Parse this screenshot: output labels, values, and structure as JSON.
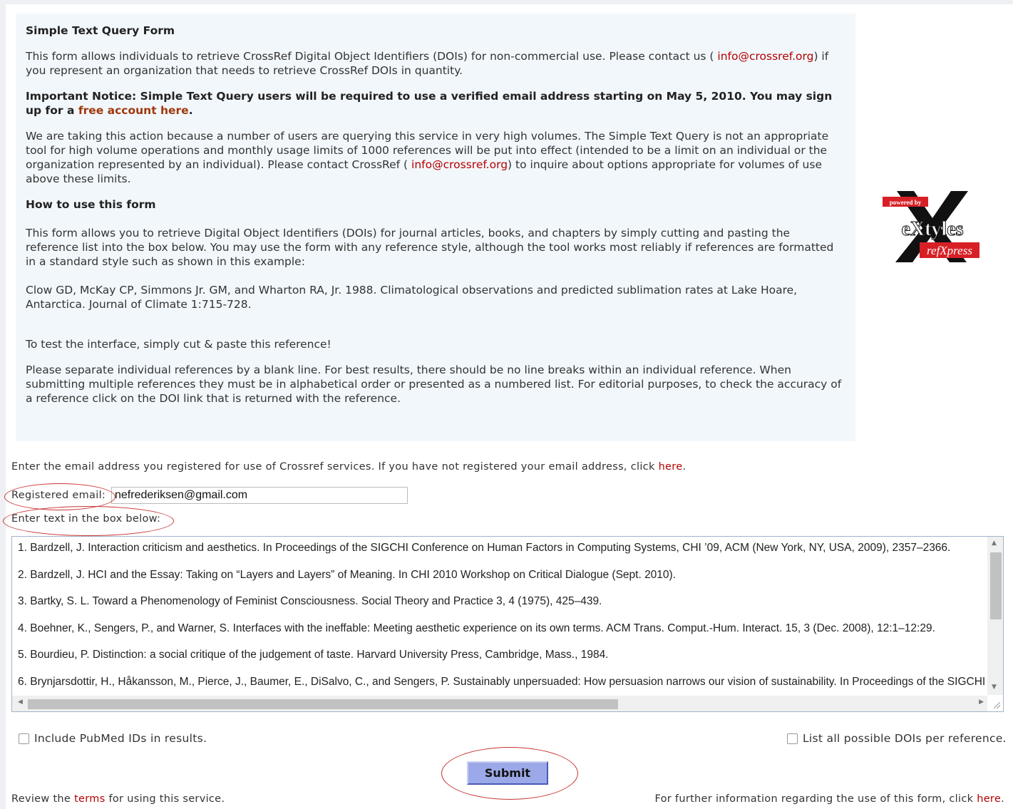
{
  "info": {
    "title": "Simple Text Query Form",
    "intro_before": "This form allows individuals to retrieve CrossRef Digital Object Identifiers (DOIs) for non-commercial use. Please contact us ( ",
    "intro_email": "info@crossref.org",
    "intro_after": ") if you represent an organization that needs to retrieve CrossRef DOIs in quantity.",
    "notice_before": "Important Notice: Simple Text Query users will be required to use a verified email address starting on May 5, 2010. You may sign up for a ",
    "notice_link": "free account here",
    "notice_after": ".",
    "action_before": "We are taking this action because a number of users are querying this service in very high volumes. The Simple Text Query is not an appropriate tool for high volume operations and monthly usage limits of 1000 references will be put into effect (intended to be a limit on an individual or the organization represented by an individual). Please contact CrossRef ( ",
    "action_email": "info@crossref.org",
    "action_after": ") to inquire about options appropriate for volumes of use above these limits.",
    "howto_title": "How to use this form",
    "howto_text": "This form allows you to retrieve Digital Object Identifiers (DOIs) for journal articles, books, and chapters by simply cutting and pasting the reference list into the box below. You may use the form with any reference style, although the tool works most reliably if references are formatted in a standard style such as shown in this example:",
    "example_ref": "Clow GD, McKay CP, Simmons Jr. GM, and Wharton RA, Jr. 1988. Climatological observations and predicted sublimation rates at Lake Hoare, Antarctica. Journal of Climate 1:715-728.",
    "test_text": "To test the interface, simply cut & paste this reference!",
    "separate_text": "Please separate individual references by a blank line. For best results, there should be no line breaks within an individual reference. When submitting multiple references they must be in alphabetical order or presented as a numbered list. For editorial purposes, to check the accuracy of a reference click on the DOI link that is returned with the reference."
  },
  "logo": {
    "tag": "powered by",
    "brand": "eXtyles",
    "product": "refXpress",
    "colors": {
      "red": "#d81f26",
      "black": "#111111"
    }
  },
  "form": {
    "register_text": "Enter the email address you registered for use of Crossref services. If you have not registered your email address, click ",
    "register_link": "here",
    "register_end": ".",
    "email_label": "Registered email:",
    "email_value": "nefrederiksen@gmail.com",
    "textbox_label": "Enter text in the box below:",
    "references": [
      "1. Bardzell, J. Interaction criticism and aesthetics. In Proceedings of the SIGCHI Conference on Human Factors in Computing Systems, CHI ’09, ACM (New York, NY, USA, 2009), 2357–2366.",
      "2. Bardzell, J. HCI and the Essay: Taking on “Layers and Layers” of Meaning. In CHI 2010 Workshop on Critical Dialogue (Sept. 2010).",
      "3. Bartky, S. L. Toward a Phenomenology of Feminist Consciousness. Social Theory and Practice 3, 4 (1975), 425–439.",
      "4. Boehner, K., Sengers, P., and Warner, S. Interfaces with the ineffable: Meeting aesthetic experience on its own terms. ACM Trans. Comput.-Hum. Interact. 15, 3 (Dec. 2008), 12:1–12:29.",
      "5. Bourdieu, P. Distinction: a social critique of the judgement of taste. Harvard University Press, Cambridge, Mass., 1984.",
      "6. Brynjarsdottir, H., Håkansson, M., Pierce, J., Baumer, E., DiSalvo, C., and Sengers, P. Sustainably unpersuaded: How persuasion narrows our vision of sustainability. In Proceedings of the SIGCHI"
    ],
    "pubmed_label": "Include PubMed IDs in results.",
    "alldois_label": "List all possible DOIs per reference.",
    "submit_label": "Submit"
  },
  "footer": {
    "terms_before": "Review the ",
    "terms_link": "terms",
    "terms_after": " for using this service.",
    "info_before": "For further information regarding the use of this form, click ",
    "info_link": "here",
    "info_after": "."
  },
  "colors": {
    "panel_bg": "#f2f7fb",
    "link_red": "#b30000",
    "link_brown": "#a0380c",
    "annotation_circle": "#c93434",
    "submit_bg": "#9ba9e8"
  }
}
